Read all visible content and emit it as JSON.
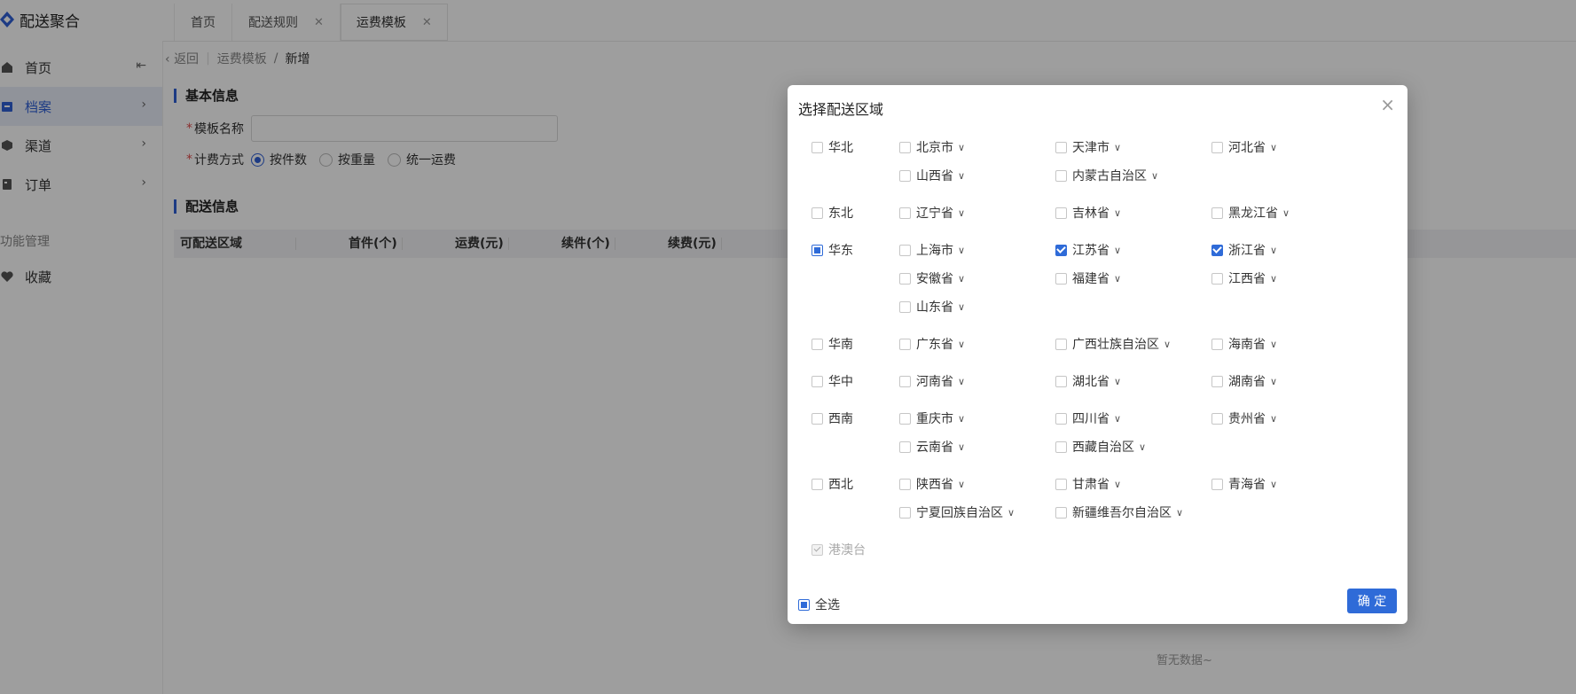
{
  "app": {
    "title": "配送聚合"
  },
  "tabs": [
    {
      "label": "首页",
      "closable": false
    },
    {
      "label": "配送规则",
      "closable": true
    },
    {
      "label": "运费模板",
      "closable": true,
      "active": true
    }
  ],
  "sidebar": {
    "items": [
      {
        "label": "首页",
        "icon": "home-icon",
        "collapse_icon": "collapse-sidebar-icon"
      },
      {
        "label": "档案",
        "icon": "archive-icon",
        "active": true
      },
      {
        "label": "渠道",
        "icon": "channel-icon"
      },
      {
        "label": "订单",
        "icon": "order-icon"
      }
    ],
    "section_label": "功能管理",
    "fav_label": "收藏"
  },
  "breadcrumb": {
    "back": "返回",
    "parent": "运费模板",
    "sep": "/",
    "current": "新增"
  },
  "form": {
    "section_basic": "基本信息",
    "name_label": "模板名称",
    "name_value": "",
    "billing_label": "计费方式",
    "billing_options": [
      "按件数",
      "按重量",
      "统一运费"
    ],
    "billing_selected": "按件数",
    "section_delivery": "配送信息"
  },
  "table": {
    "headers": [
      "可配送区域",
      "首件(个)",
      "运费(元)",
      "续件(个)",
      "续费(元)"
    ],
    "empty_text": "暂无数据~"
  },
  "modal": {
    "title": "选择配送区域",
    "regions": [
      {
        "label": "华北",
        "state": "unchecked",
        "provinces": [
          {
            "label": "北京市",
            "checked": false
          },
          {
            "label": "天津市",
            "checked": false
          },
          {
            "label": "河北省",
            "checked": false
          },
          {
            "label": "山西省",
            "checked": false
          },
          {
            "label": "内蒙古自治区",
            "checked": false
          }
        ]
      },
      {
        "label": "东北",
        "state": "unchecked",
        "provinces": [
          {
            "label": "辽宁省",
            "checked": false
          },
          {
            "label": "吉林省",
            "checked": false
          },
          {
            "label": "黑龙江省",
            "checked": false
          }
        ]
      },
      {
        "label": "华东",
        "state": "partial",
        "provinces": [
          {
            "label": "上海市",
            "checked": false
          },
          {
            "label": "江苏省",
            "checked": true
          },
          {
            "label": "浙江省",
            "checked": true
          },
          {
            "label": "安徽省",
            "checked": false
          },
          {
            "label": "福建省",
            "checked": false
          },
          {
            "label": "江西省",
            "checked": false
          },
          {
            "label": "山东省",
            "checked": false
          }
        ]
      },
      {
        "label": "华南",
        "state": "unchecked",
        "provinces": [
          {
            "label": "广东省",
            "checked": false
          },
          {
            "label": "广西壮族自治区",
            "checked": false
          },
          {
            "label": "海南省",
            "checked": false
          }
        ]
      },
      {
        "label": "华中",
        "state": "unchecked",
        "provinces": [
          {
            "label": "河南省",
            "checked": false
          },
          {
            "label": "湖北省",
            "checked": false
          },
          {
            "label": "湖南省",
            "checked": false
          }
        ]
      },
      {
        "label": "西南",
        "state": "unchecked",
        "provinces": [
          {
            "label": "重庆市",
            "checked": false
          },
          {
            "label": "四川省",
            "checked": false
          },
          {
            "label": "贵州省",
            "checked": false
          },
          {
            "label": "云南省",
            "checked": false
          },
          {
            "label": "西藏自治区",
            "checked": false
          }
        ]
      },
      {
        "label": "西北",
        "state": "unchecked",
        "provinces": [
          {
            "label": "陕西省",
            "checked": false
          },
          {
            "label": "甘肃省",
            "checked": false
          },
          {
            "label": "青海省",
            "checked": false
          },
          {
            "label": "宁夏回族自治区",
            "checked": false
          },
          {
            "label": "新疆维吾尔自治区",
            "checked": false
          }
        ]
      },
      {
        "label": "港澳台",
        "state": "disabled",
        "provinces": []
      }
    ],
    "select_all_label": "全选",
    "select_all_state": "partial",
    "confirm_label": "确 定"
  },
  "colors": {
    "accent": "#2f6bd8",
    "required": "#e04b4b",
    "mask": "rgba(0,0,0,0.38)"
  }
}
